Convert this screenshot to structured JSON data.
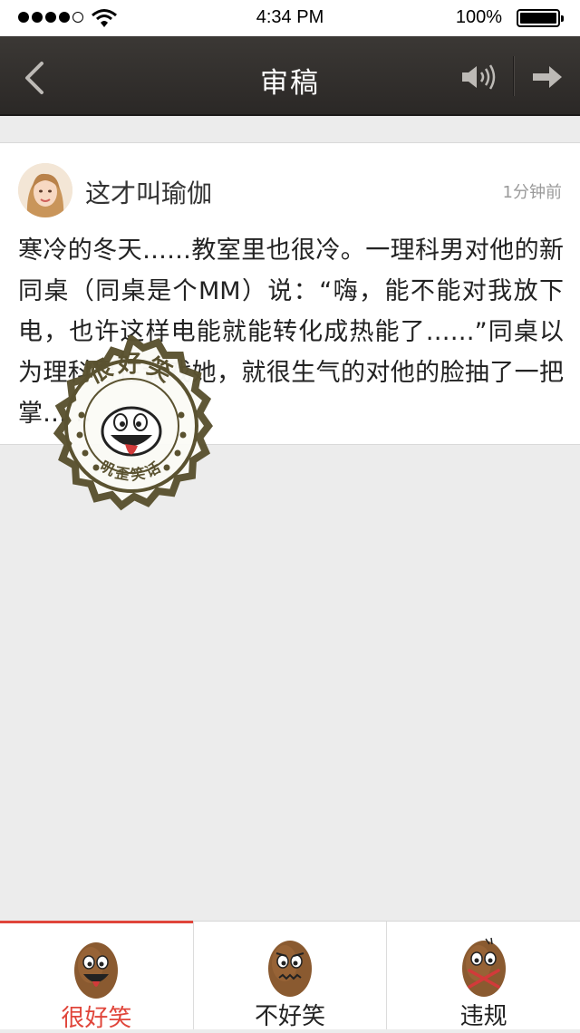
{
  "status_bar": {
    "time": "4:34 PM",
    "battery": "100%",
    "icons": [
      "signal-dots-icon",
      "wifi-icon",
      "battery-icon"
    ]
  },
  "nav": {
    "title": "审稿",
    "icons": [
      "back-arrow-icon",
      "speaker-icon",
      "next-arrow-icon"
    ]
  },
  "post": {
    "author": "这才叫瑜伽",
    "time": "1分钟前",
    "body": "寒冷的冬天……教室里也很冷。一理科男对他的新同桌（同桌是个MM）说：“嗨，能不能对我放下电，也许这样电能就能转化成热能了……”同桌以为理科男在调戏她，就很生气的对他的脸抽了一把掌……"
  },
  "stamp": {
    "top_text": "很好笑",
    "bottom_text": "叽歪笑话"
  },
  "tabs": [
    {
      "label": "很好笑",
      "icon": "laughing-potato-icon",
      "active": true
    },
    {
      "label": "不好笑",
      "icon": "worried-potato-icon",
      "active": false
    },
    {
      "label": "违规",
      "icon": "crossed-potato-icon",
      "active": false
    }
  ],
  "colors": {
    "nav_bg": "#2f2c2a",
    "accent": "#e0453a",
    "stamp": "#5a5230",
    "potato": "#8a5a30"
  }
}
